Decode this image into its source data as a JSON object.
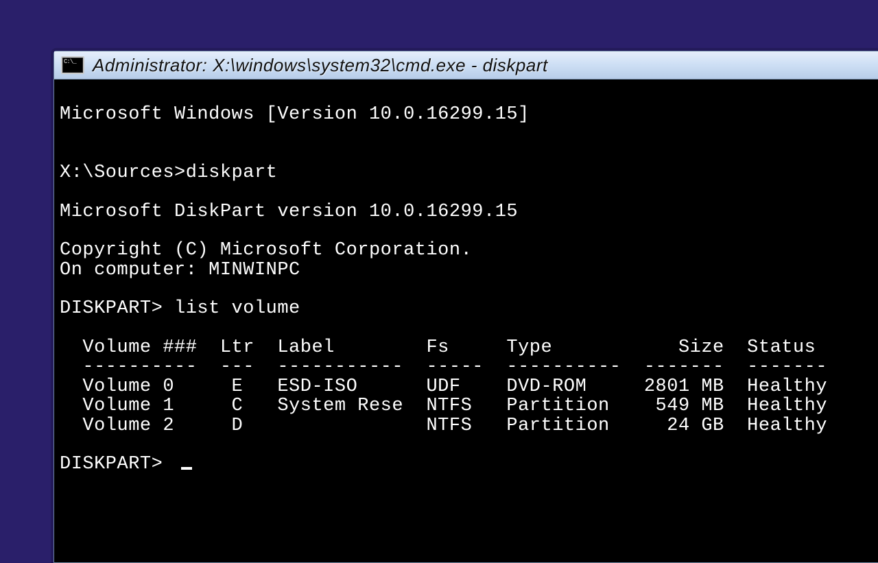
{
  "titlebar": {
    "title": "Administrator: X:\\windows\\system32\\cmd.exe - diskpart"
  },
  "console": {
    "banner": "Microsoft Windows [Version 10.0.16299.15]",
    "prompt_cmd": "X:\\Sources>diskpart",
    "dp_version": "Microsoft DiskPart version 10.0.16299.15",
    "copyright": "Copyright (C) Microsoft Corporation.",
    "computer": "On computer: MINWINPC",
    "dp_prompt1": "DISKPART> list volume",
    "dp_prompt2": "DISKPART> "
  },
  "volumes": {
    "headers": [
      "Volume ###",
      "Ltr",
      "Label",
      "Fs",
      "Type",
      "Size",
      "Status"
    ],
    "rows": [
      {
        "num": "Volume 0",
        "ltr": "E",
        "label": "ESD-ISO",
        "fs": "UDF",
        "type": "DVD-ROM",
        "size": "2801 MB",
        "status": "Healthy"
      },
      {
        "num": "Volume 1",
        "ltr": "C",
        "label": "System Rese",
        "fs": "NTFS",
        "type": "Partition",
        "size": "549 MB",
        "status": "Healthy"
      },
      {
        "num": "Volume 2",
        "ltr": "D",
        "label": "",
        "fs": "NTFS",
        "type": "Partition",
        "size": "24 GB",
        "status": "Healthy"
      }
    ]
  }
}
